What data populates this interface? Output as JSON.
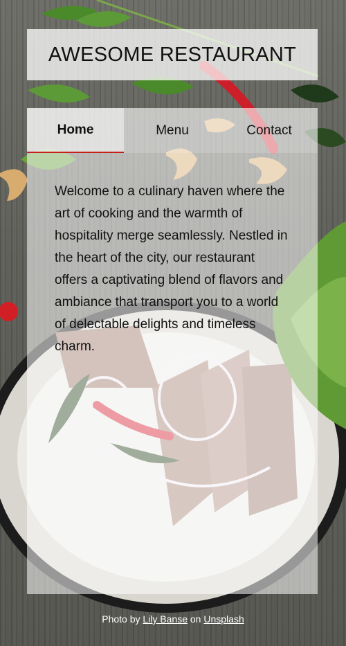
{
  "header": {
    "title": "AWESOME RESTAURANT"
  },
  "nav": {
    "tabs": [
      {
        "label": "Home",
        "active": true
      },
      {
        "label": "Menu",
        "active": false
      },
      {
        "label": "Contact",
        "active": false
      }
    ]
  },
  "main": {
    "intro": "Welcome to a culinary haven where the art of cooking and the warmth of hospitality merge seamlessly. Nestled in the heart of the city, our restaurant offers a captivating blend of flavors and ambiance that transport you to a world of delectable delights and timeless charm."
  },
  "footer": {
    "credit_prefix": "Photo by ",
    "photographer": "Lily Banse",
    "credit_middle": " on ",
    "source": "Unsplash"
  },
  "colors": {
    "accent": "#c4201c",
    "text": "#111111",
    "wood": "#5e5e58"
  }
}
